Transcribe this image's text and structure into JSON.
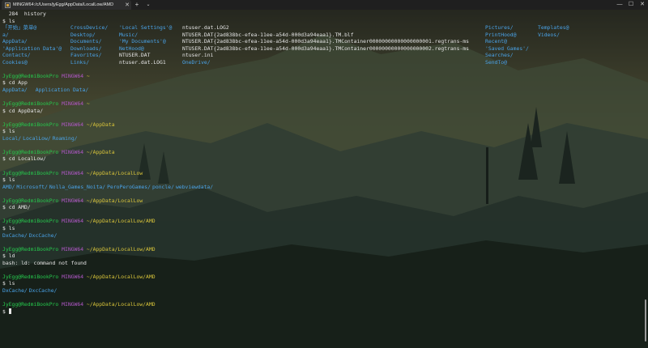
{
  "window": {
    "tab_title": "MINGW64:/c/Users/jyEgg/AppData/LocalLow/AMD",
    "tab_icon": "terminal-icon",
    "new_tab": "+",
    "dropdown": "⌄",
    "minimize": "—",
    "maximize": "☐",
    "close": "✕",
    "close_tab": "✕"
  },
  "colors": {
    "user_host": "#26c84d",
    "mingw": "#b258c8",
    "path": "#d8c43a",
    "directory": "#4aa3e8",
    "text": "#dcdcdc"
  },
  "prompt": {
    "user_host": "JyEgg@RedmiBookPro",
    "env": "MINGW64",
    "dollar": "$"
  },
  "history_line": "  284  history",
  "ls_home": {
    "command": "ls",
    "rows": [
      [
        "「开始」菜单@",
        "CrossDevice/",
        "'Local Settings'@",
        "ntuser.dat.LOG2",
        "Pictures/",
        "Templates@"
      ],
      [
        "a/",
        "Desktop/",
        "Music/",
        "NTUSER.DAT{2ad838bc-efea-11ee-a54d-000d3a94eaa1}.TM.blf",
        "PrintHood@",
        "Videos/"
      ],
      [
        "AppData/",
        "Documents/",
        "'My Documents'@",
        "NTUSER.DAT{2ad838bc-efea-11ee-a54d-000d3a94eaa1}.TMContainer00000000000000000001.regtrans-ms",
        "Recent@",
        ""
      ],
      [
        "'Application Data'@",
        "Downloads/",
        "NetHood@",
        "NTUSER.DAT{2ad838bc-efea-11ee-a54d-000d3a94eaa1}.TMContainer00000000000000000002.regtrans-ms",
        "'Saved Games'/",
        ""
      ],
      [
        "Contacts/",
        "Favorites/",
        "NTUSER.DAT",
        "ntuser.ini",
        "Searches/",
        ""
      ],
      [
        "Cookies@",
        "Links/",
        "ntuser.dat.LOG1",
        "OneDrive/",
        "SendTo@",
        ""
      ]
    ]
  },
  "blocks": [
    {
      "path": "~",
      "command": "cd App",
      "output_type": "dirs",
      "output": [
        "AppData/",
        "Application Data/"
      ],
      "gap": 10
    },
    {
      "path": "~",
      "command": "cd AppData/",
      "output_type": "none"
    },
    {
      "path": "~/AppData",
      "command": "ls",
      "output_type": "dirs",
      "output": [
        "Local/",
        "LocalLow/",
        "Roaming/"
      ],
      "gap": 2
    },
    {
      "path": "~/AppData",
      "command": "cd LocalLow/",
      "output_type": "none"
    },
    {
      "path": "~/AppData/LocalLow",
      "command": "ls",
      "output_type": "dirs",
      "output": [
        "AMD/",
        "Microsoft/",
        "Nolla_Games_Noita/",
        "PeroPeroGames/",
        "poncle/",
        "webviewdata/"
      ],
      "gap": 2
    },
    {
      "path": "~/AppData/LocalLow",
      "command": "cd AMD/",
      "output_type": "none"
    },
    {
      "path": "~/AppData/LocalLow/AMD",
      "command": "ls",
      "output_type": "dirs",
      "output": [
        "DxCache/",
        "DxcCache/"
      ],
      "gap": 2
    },
    {
      "path": "~/AppData/LocalLow/AMD",
      "command": "ld",
      "output_type": "text",
      "output": [
        "bash: ld: command not found"
      ]
    },
    {
      "path": "~/AppData/LocalLow/AMD",
      "command": "ls",
      "output_type": "dirs",
      "output": [
        "DxCache/",
        "DxcCache/"
      ],
      "gap": 2
    },
    {
      "path": "~/AppData/LocalLow/AMD",
      "command": "",
      "output_type": "cursor"
    }
  ]
}
